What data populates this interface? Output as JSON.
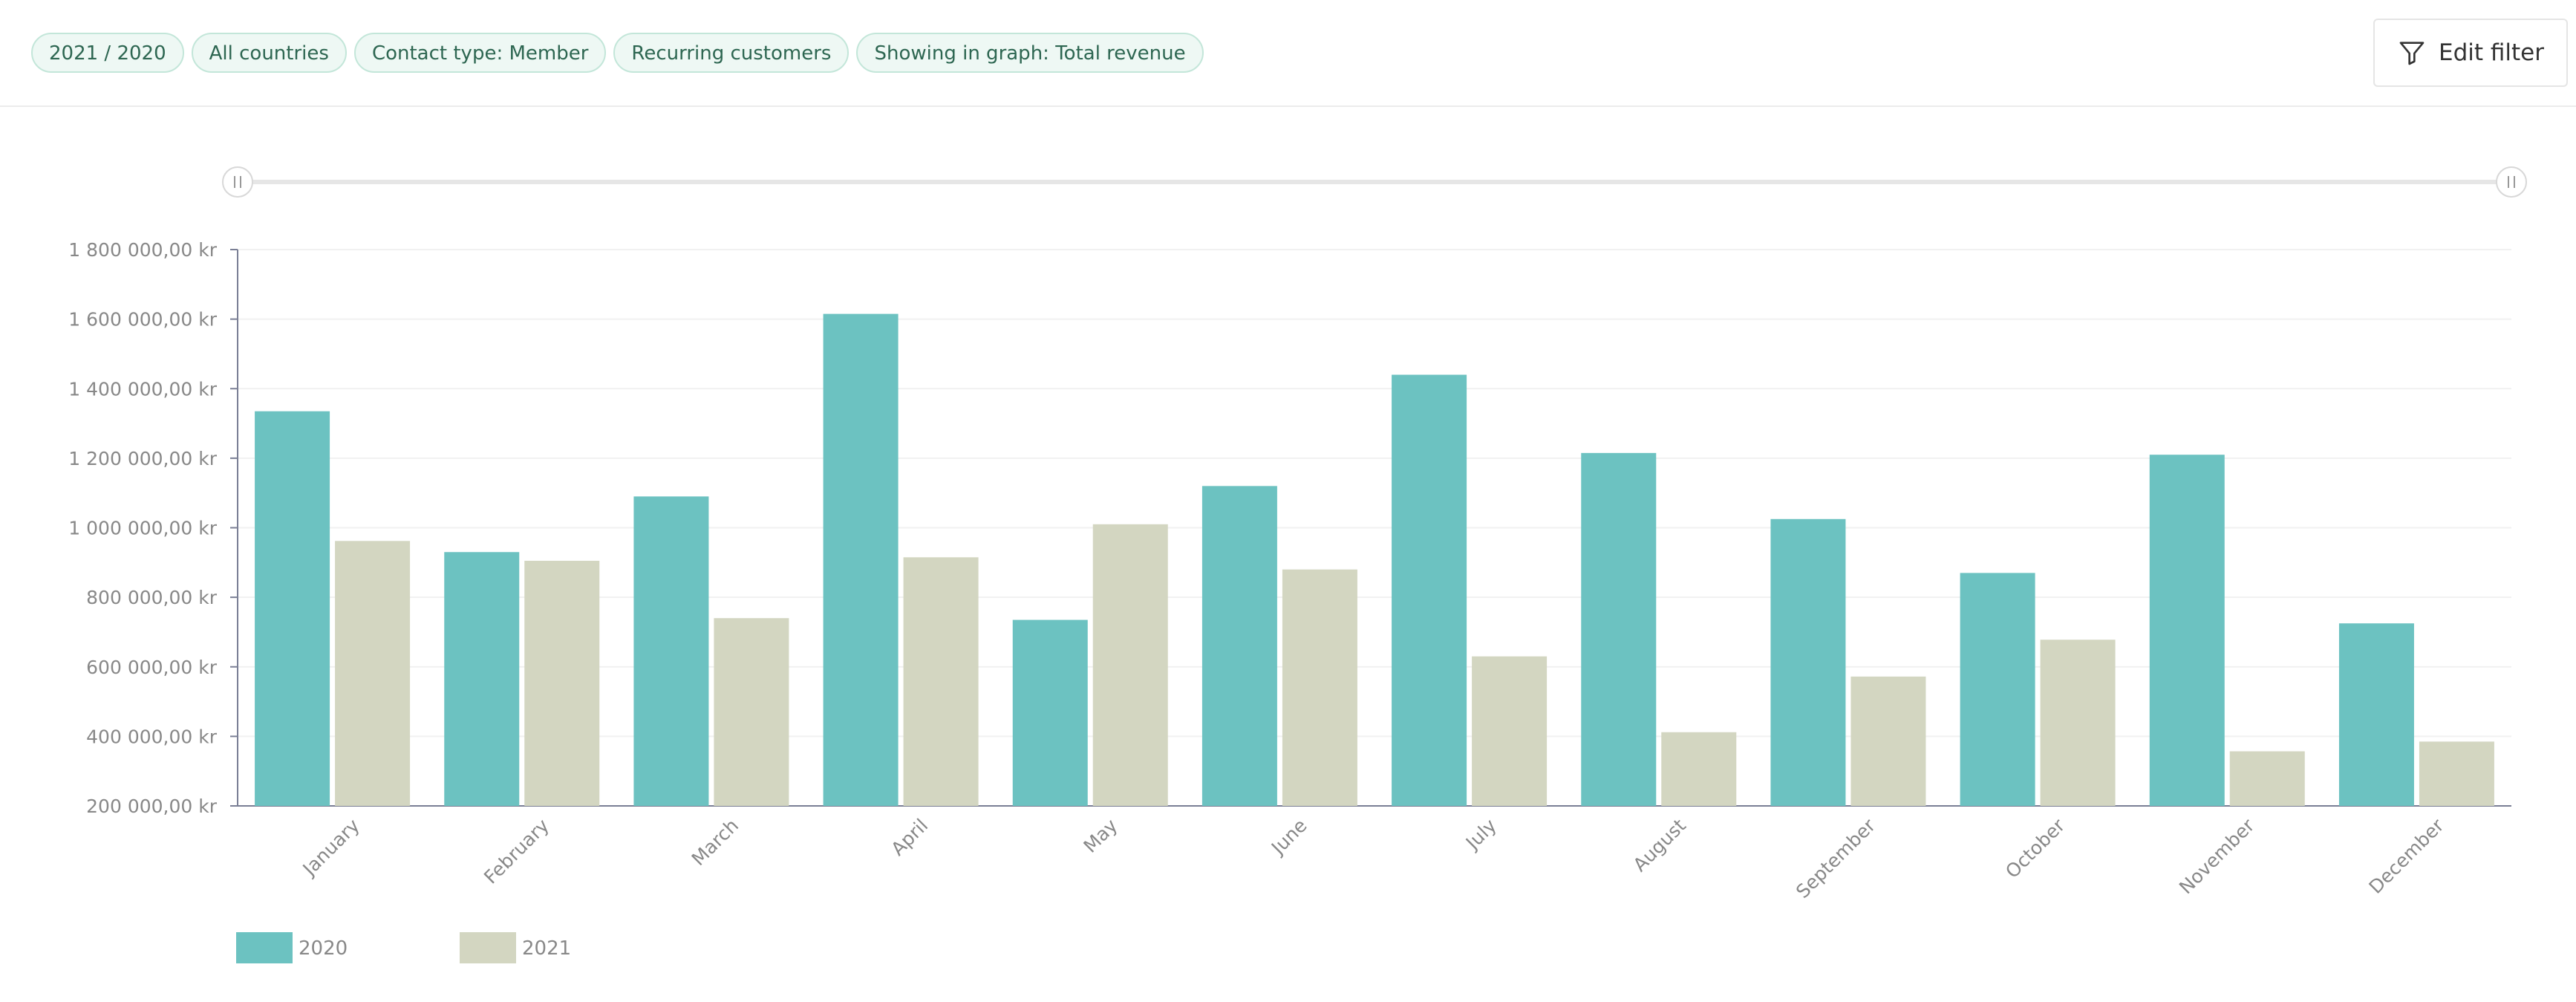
{
  "filters": {
    "chips": [
      "2021 / 2020",
      "All countries",
      "Contact type: Member",
      "Recurring customers",
      "Showing in graph: Total revenue"
    ],
    "edit_label": "Edit filter"
  },
  "colors": {
    "series_2020": "#6cc2c1",
    "series_2021": "#d3d6c1",
    "axis": "#7a7f95",
    "grid": "#f1f1f1",
    "tick_text": "#888888"
  },
  "chart_data": {
    "type": "bar",
    "title": "",
    "xlabel": "",
    "ylabel": "",
    "categories": [
      "January",
      "February",
      "March",
      "April",
      "May",
      "June",
      "July",
      "August",
      "September",
      "October",
      "November",
      "December"
    ],
    "series": [
      {
        "name": "2020",
        "values": [
          1335000,
          930000,
          1090000,
          1615000,
          735000,
          1120000,
          1440000,
          1215000,
          1025000,
          870000,
          1210000,
          725000
        ]
      },
      {
        "name": "2021",
        "values": [
          962000,
          905000,
          740000,
          915000,
          1010000,
          880000,
          630000,
          412000,
          572000,
          678000,
          357000,
          385000
        ]
      }
    ],
    "ylim": [
      200000,
      1800000
    ],
    "yticks": [
      200000,
      400000,
      600000,
      800000,
      1000000,
      1200000,
      1400000,
      1600000,
      1800000
    ],
    "ytick_labels": [
      "200 000,00 kr",
      "400 000,00 kr",
      "600 000,00 kr",
      "800 000,00 kr",
      "1 000 000,00 kr",
      "1 200 000,00 kr",
      "1 400 000,00 kr",
      "1 600 000,00 kr",
      "1 800 000,00 kr"
    ],
    "grid": true,
    "legend_position": "bottom-left",
    "range_slider": true
  }
}
